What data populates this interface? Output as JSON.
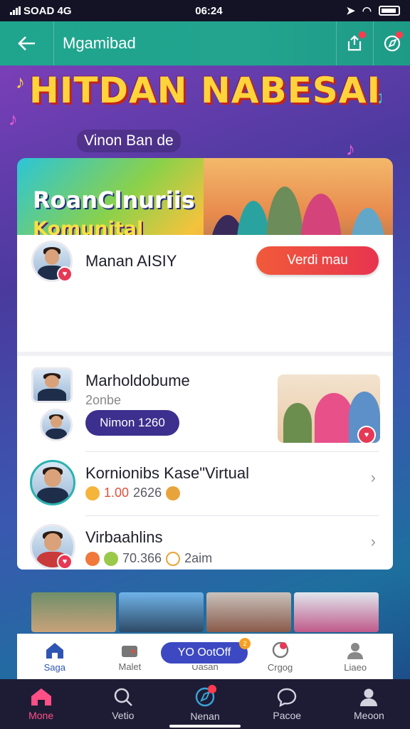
{
  "status": {
    "carrier": "SOAD 4G",
    "time": "06:24"
  },
  "header": {
    "title": "Mgamibad"
  },
  "hero": {
    "title": "HITDAN NABESAI",
    "subtitle": "Vinon Ban de"
  },
  "banner": {
    "headline": "RoanClnuriis",
    "tagline": "Komunital"
  },
  "card": {
    "top_row": {
      "name": "Manan AISIY",
      "button": "Verdi mau"
    },
    "rows": [
      {
        "title": "Marholdobume",
        "subtitle": "2onbe",
        "pill": "Nimon 1260"
      },
      {
        "title": "Kornionibs Kase\"Virtual",
        "stat_value": "1.00",
        "stat_extra": "2626"
      },
      {
        "title": "Virbaahlins",
        "stat_value": "70.366",
        "stat_extra": "2aim"
      }
    ]
  },
  "inner_tabs": [
    {
      "label": "Saga",
      "icon": "home-icon",
      "active": true
    },
    {
      "label": "Malet",
      "icon": "wallet-icon",
      "active": false
    },
    {
      "label": "Uasan",
      "icon": "music-icon",
      "active": false
    },
    {
      "label": "Crgog",
      "icon": "chat-icon",
      "active": false
    },
    {
      "label": "Liaeo",
      "icon": "profile-icon",
      "active": false
    }
  ],
  "floating_pill": {
    "label": "YO OotOff",
    "badge": "2"
  },
  "bottom_nav": [
    {
      "label": "Mone",
      "icon": "home-icon",
      "active": true
    },
    {
      "label": "Vetio",
      "icon": "search-icon",
      "active": false
    },
    {
      "label": "Nenan",
      "icon": "compass-icon",
      "active": false
    },
    {
      "label": "Pacoe",
      "icon": "chat-icon",
      "active": false
    },
    {
      "label": "Meoon",
      "icon": "profile-icon",
      "active": false
    }
  ],
  "colors": {
    "header": "#22a48f",
    "accent": "#e8344f",
    "active_nav": "#ff4f86",
    "pill": "#3c2f8e"
  }
}
